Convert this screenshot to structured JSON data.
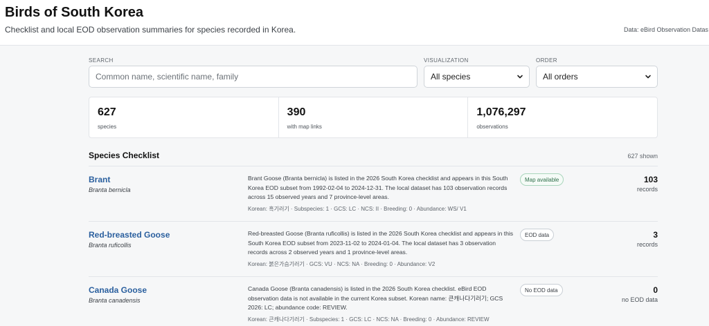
{
  "header": {
    "title": "Birds of South Korea",
    "subtitle": "Checklist and local EOD observation summaries for species recorded in Korea.",
    "data_source": "Data: eBird Observation Datas"
  },
  "filters": {
    "search_label": "SEARCH",
    "search_placeholder": "Common name, scientific name, family",
    "visualization_label": "VISUALIZATION",
    "visualization_value": "All species",
    "order_label": "ORDER",
    "order_value": "All orders"
  },
  "stats": [
    {
      "value": "627",
      "label": "species"
    },
    {
      "value": "390",
      "label": "with map links"
    },
    {
      "value": "1,076,297",
      "label": "observations"
    }
  ],
  "checklist": {
    "title": "Species Checklist",
    "shown": "627 shown",
    "rows": [
      {
        "common": "Brant",
        "scientific": "Branta bernicla",
        "description": "Brant Goose (Branta bernicla) is listed in the 2026 South Korea checklist and appears in this South Korea EOD subset from 1992-02-04 to 2024-12-31. The local dataset has 103 observation records across 15 observed years and 7 province-level areas.",
        "meta": "Korean: 흑기러기 · Subspecies: 1 · GCS: LC · NCS: II · Breeding: 0 · Abundance: WS/ V1",
        "badge": "Map available",
        "badge_type": "map",
        "count": "103",
        "count_label": "records"
      },
      {
        "common": "Red-breasted Goose",
        "scientific": "Branta ruficollis",
        "description": "Red-breasted Goose (Branta ruficollis) is listed in the 2026 South Korea checklist and appears in this South Korea EOD subset from 2023-11-02 to 2024-01-04. The local dataset has 3 observation records across 2 observed years and 1 province-level areas.",
        "meta": "Korean: 붉은가슴기러기 · GCS: VU · NCS: NA · Breeding: 0 · Abundance: V2",
        "badge": "EOD data",
        "badge_type": "eod",
        "count": "3",
        "count_label": "records"
      },
      {
        "common": "Canada Goose",
        "scientific": "Branta canadensis",
        "description": "Canada Goose (Branta canadensis) is listed in the 2026 South Korea checklist. eBird EOD observation data is not available in the current Korea subset. Korean name: 큰캐나다기러기; GCS 2026: LC; abundance code: REVIEW.",
        "meta": "Korean: 큰캐나다기러기 · Subspecies: 1 · GCS: LC · NCS: NA · Breeding: 0 · Abundance: REVIEW",
        "badge": "No EOD data",
        "badge_type": "none",
        "count": "0",
        "count_label": "no EOD data"
      }
    ]
  }
}
